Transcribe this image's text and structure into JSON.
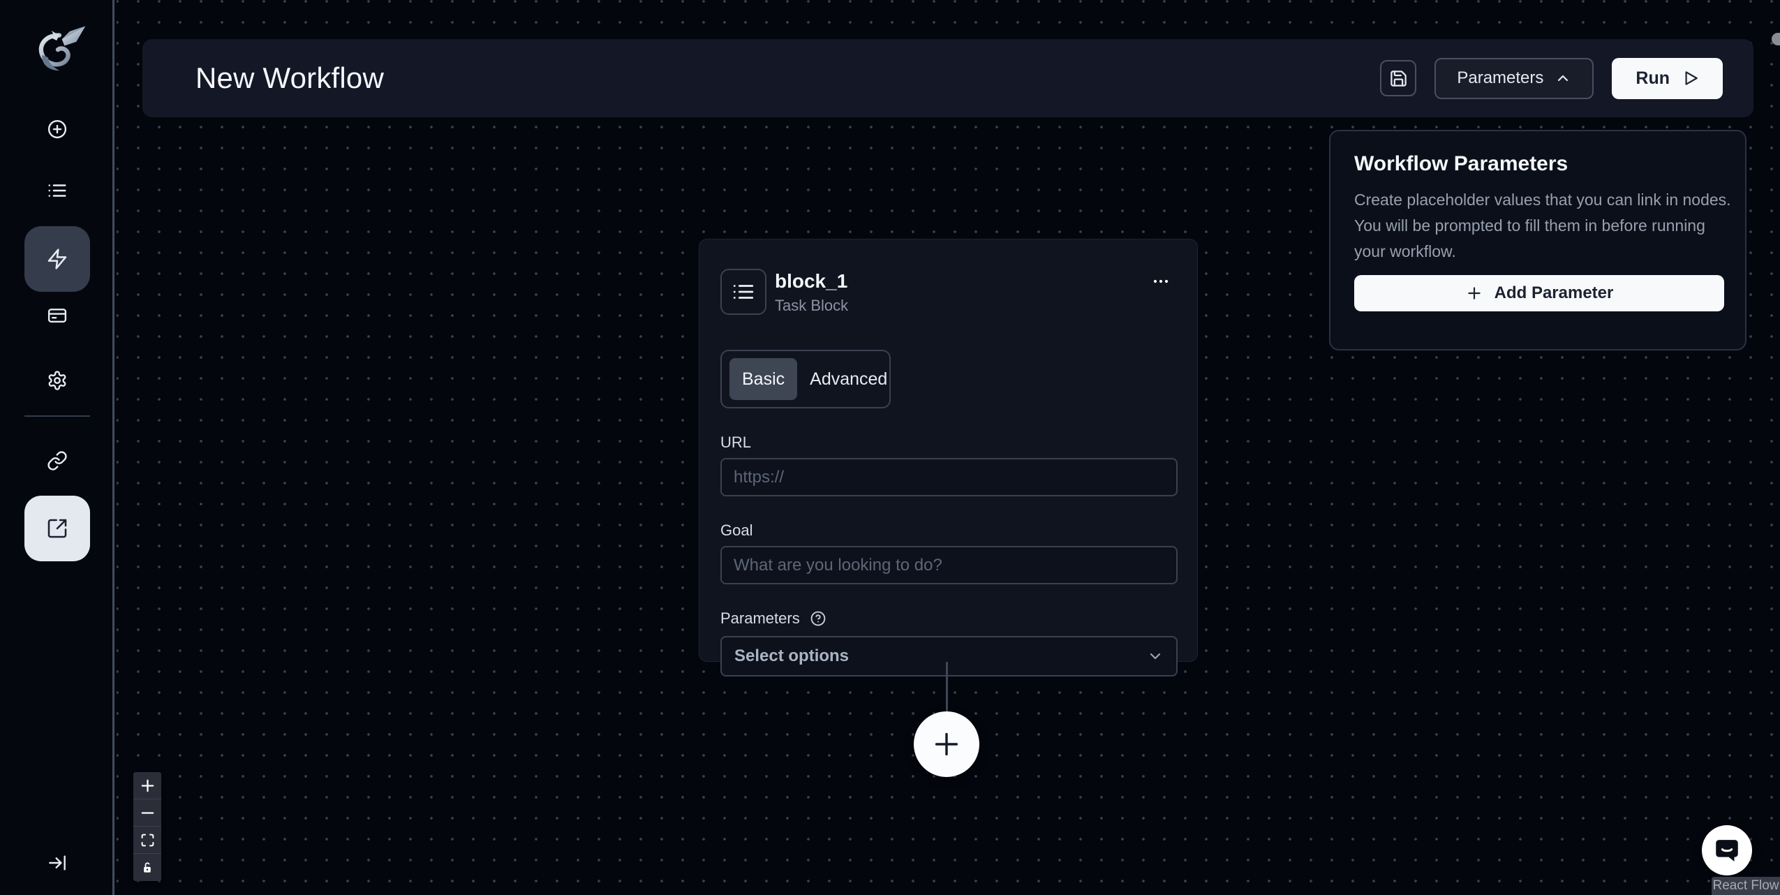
{
  "header": {
    "title": "New Workflow",
    "save_icon": "floppy-disk",
    "parameters_label": "Parameters",
    "parameters_chevron_icon": "chevron-up",
    "run_label": "Run",
    "run_icon": "play-outline"
  },
  "sidebar": {
    "logo_icon": "skyvern-dragon-logo",
    "items": [
      {
        "name": "create",
        "icon": "plus-circle",
        "active": false
      },
      {
        "name": "runs",
        "icon": "list",
        "active": false
      },
      {
        "name": "workflows",
        "icon": "lightning-bolt",
        "active": true
      },
      {
        "name": "credentials",
        "icon": "credit-card",
        "active": false
      },
      {
        "name": "settings",
        "icon": "gear",
        "active": false
      },
      {
        "name": "integrations",
        "icon": "chain-link",
        "active": false
      },
      {
        "name": "external-app",
        "icon": "arrow-out-of-box",
        "active": true
      }
    ],
    "collapse_icon": "arrow-right-to-bar"
  },
  "node": {
    "title": "block_1",
    "subtitle": "Task Block",
    "type_icon": "list",
    "menu_icon": "ellipsis-horizontal",
    "tabs": [
      {
        "label": "Basic",
        "active": true
      },
      {
        "label": "Advanced",
        "active": false
      }
    ],
    "url_label": "URL",
    "url_value": "",
    "url_placeholder": "https://",
    "goal_label": "Goal",
    "goal_value": "",
    "goal_placeholder": "What are you looking to do?",
    "parameters_label": "Parameters",
    "parameters_help_icon": "question-mark-circle",
    "select_placeholder": "Select options",
    "select_chevron_icon": "chevron-down"
  },
  "canvas": {
    "add_node_icon": "plus",
    "controls": [
      {
        "name": "zoom-in",
        "icon": "plus"
      },
      {
        "name": "zoom-out",
        "icon": "minus"
      },
      {
        "name": "fit-view",
        "icon": "corner-brackets"
      },
      {
        "name": "toggle-interactivity",
        "icon": "unlocked-padlock"
      }
    ],
    "attribution": "React Flow"
  },
  "params_panel": {
    "title": "Workflow Parameters",
    "description": "Create placeholder values that you can link in nodes. You will be prompted to fill them in before running your workflow.",
    "add_icon": "plus",
    "add_label": "Add Parameter"
  },
  "chat": {
    "icon": "chat-bubble"
  },
  "colors": {
    "canvas_bg": "#04060e",
    "panel_bg": "#141826",
    "card_bg": "#10141f",
    "border": "#3a4150",
    "accent_light": "#f7f9fb",
    "text_primary": "#f1f5f9",
    "text_muted": "#8b94a3",
    "active_tab_bg": "#3e4553",
    "sidebar_active_bg": "#353c4b",
    "sidebar_active_light_bg": "#e4e9f0",
    "dot_color": "#3a4150"
  }
}
